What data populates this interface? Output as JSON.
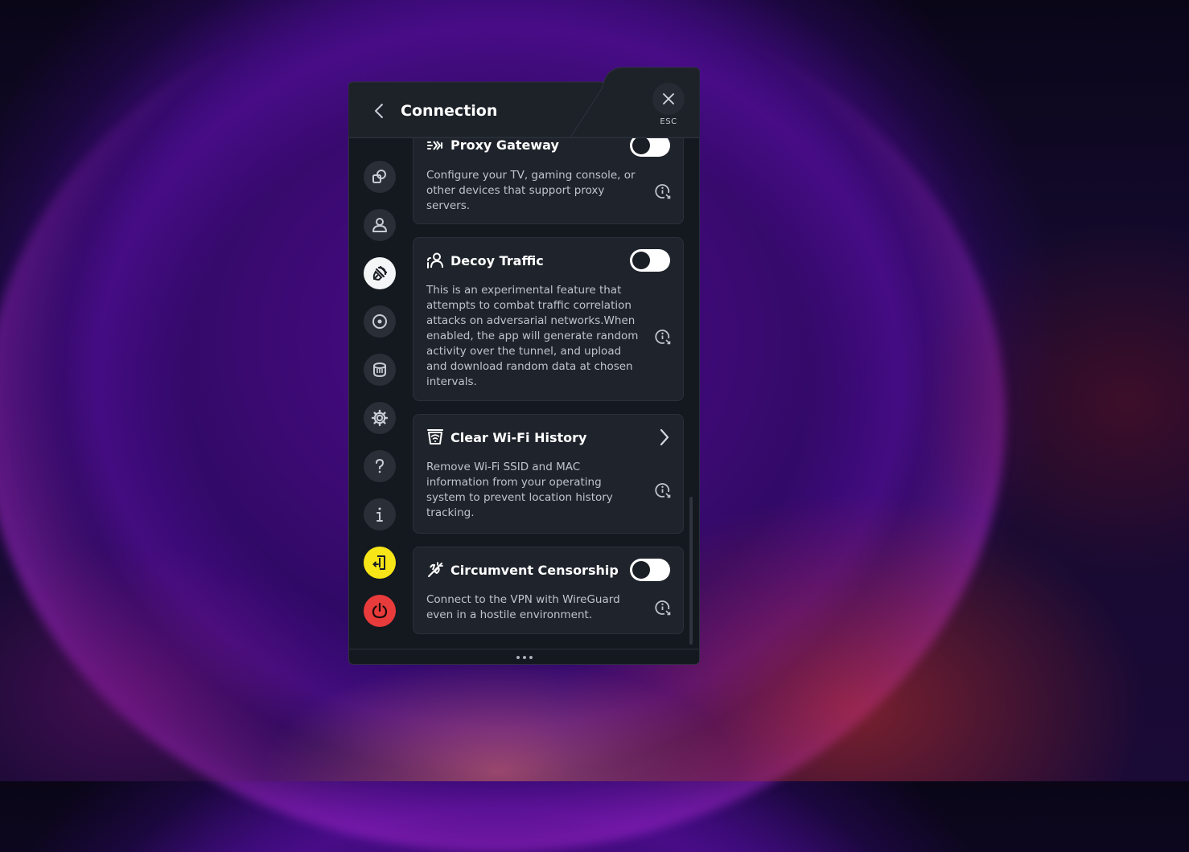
{
  "header": {
    "title": "Connection",
    "close_hint": "ESC"
  },
  "sidebar": {
    "items": [
      {
        "icon": "devices-icon",
        "state": "default"
      },
      {
        "icon": "account-icon",
        "state": "default"
      },
      {
        "icon": "connection-plug-icon",
        "state": "active"
      },
      {
        "icon": "location-target-icon",
        "state": "default"
      },
      {
        "icon": "robert-dns-icon",
        "state": "default"
      },
      {
        "icon": "gear-icon",
        "state": "default"
      },
      {
        "icon": "help-icon",
        "state": "default"
      },
      {
        "icon": "about-info-icon",
        "state": "default"
      },
      {
        "icon": "sign-out-icon",
        "state": "yellow"
      },
      {
        "icon": "power-icon",
        "state": "red"
      }
    ]
  },
  "cards": [
    {
      "title": "Proxy Gateway",
      "description": "Configure your TV, gaming console, or other devices that support proxy servers.",
      "control": "toggle",
      "enabled": false
    },
    {
      "title": "Decoy Traffic",
      "description": "This is an experimental feature that attempts to combat traffic correlation attacks on adversarial networks.When enabled, the app will generate random activity over the tunnel, and upload and download random data at chosen intervals.",
      "control": "toggle",
      "enabled": false
    },
    {
      "title": "Clear Wi-Fi History",
      "description": "Remove Wi-Fi SSID and MAC information from your operating system to prevent location history tracking.",
      "control": "chevron"
    },
    {
      "title": "Circumvent Censorship",
      "description": "Connect to the VPN with WireGuard even in a hostile environment.",
      "control": "toggle",
      "enabled": false
    }
  ],
  "colors": {
    "panel_bg": "#14181f",
    "card_bg": "#1f242c",
    "accent_yellow": "#f7e517",
    "accent_red": "#e83b3b"
  }
}
